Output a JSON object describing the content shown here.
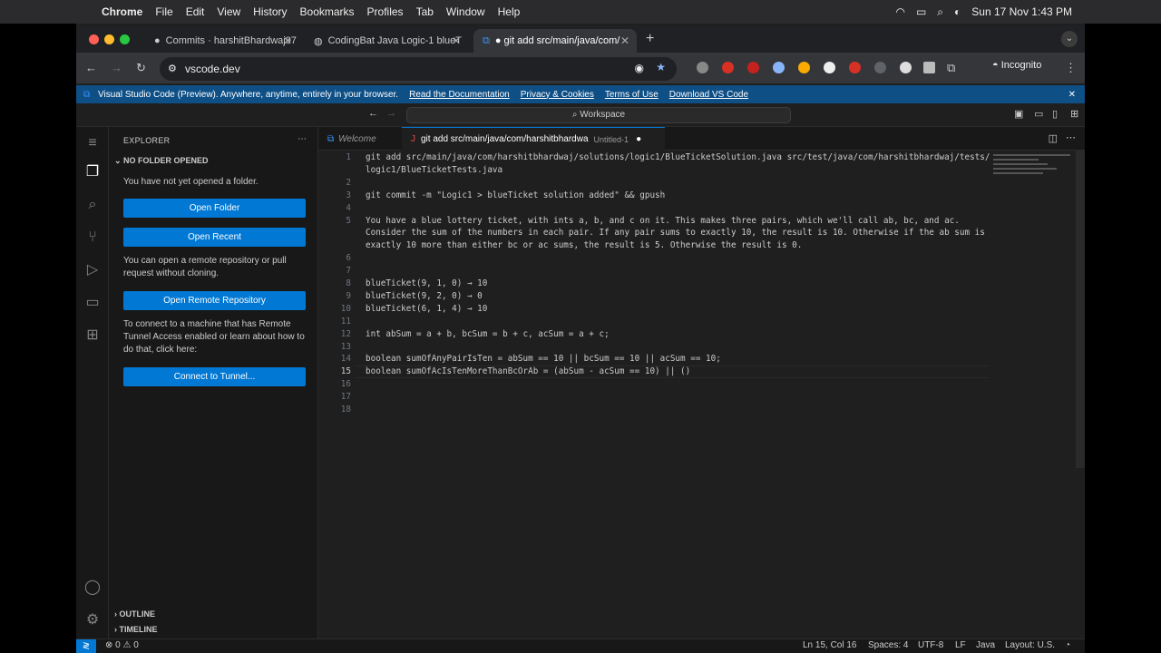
{
  "menubar": {
    "items": [
      "Chrome",
      "File",
      "Edit",
      "View",
      "History",
      "Bookmarks",
      "Profiles",
      "Tab",
      "Window",
      "Help"
    ],
    "clock": "Sun 17 Nov  1:43 PM"
  },
  "tabs": [
    {
      "title": "Commits · harshitBhardwaj97",
      "close": "✕"
    },
    {
      "title": "CodingBat Java Logic-1 blueT",
      "close": "✕"
    },
    {
      "title": "● git add src/main/java/com/",
      "close": "✕"
    }
  ],
  "newtab": "+",
  "address": {
    "url": "vscode.dev"
  },
  "incognito": "Incognito",
  "banner": {
    "text": "Visual Studio Code (Preview). Anywhere, anytime, entirely in your browser.",
    "links": [
      "Read the Documentation",
      "Privacy & Cookies",
      "Terms of Use",
      "Download VS Code"
    ],
    "close": "✕"
  },
  "command_center": "Workspace",
  "sidebar": {
    "title": "EXPLORER",
    "section": "NO FOLDER OPENED",
    "msg1": "You have not yet opened a folder.",
    "btn_open_folder": "Open Folder",
    "btn_open_recent": "Open Recent",
    "msg2": "You can open a remote repository or pull request without cloning.",
    "btn_remote": "Open Remote Repository",
    "msg3": "To connect to a machine that has Remote Tunnel Access enabled or learn about how to do that, click here:",
    "btn_tunnel": "Connect to Tunnel...",
    "outline": "OUTLINE",
    "timeline": "TIMELINE"
  },
  "editor_tabs": [
    {
      "label": "Welcome",
      "desc": ""
    },
    {
      "label": "git add src/main/java/com/harshitbhardwa",
      "desc": "Untitled-1",
      "dirty": "●"
    }
  ],
  "code_lines": [
    {
      "n": "1",
      "t": "git add src/main/java/com/harshitbhardwaj/solutions/logic1/BlueTicketSolution.java src/test/java/com/harshitbhardwaj/tests/"
    },
    {
      "n": "",
      "t": "logic1/BlueTicketTests.java"
    },
    {
      "n": "2",
      "t": ""
    },
    {
      "n": "3",
      "t": "git commit -m \"Logic1 > blueTicket solution added\" && gpush"
    },
    {
      "n": "4",
      "t": ""
    },
    {
      "n": "5",
      "t": "You have a blue lottery ticket, with ints a, b, and c on it. This makes three pairs, which we'll call ab, bc, and ac."
    },
    {
      "n": "",
      "t": "Consider the sum of the numbers in each pair. If any pair sums to exactly 10, the result is 10. Otherwise if the ab sum is"
    },
    {
      "n": "",
      "t": "exactly 10 more than either bc or ac sums, the result is 5. Otherwise the result is 0."
    },
    {
      "n": "6",
      "t": ""
    },
    {
      "n": "7",
      "t": ""
    },
    {
      "n": "8",
      "t": "blueTicket(9, 1, 0) → 10"
    },
    {
      "n": "9",
      "t": "blueTicket(9, 2, 0) → 0"
    },
    {
      "n": "10",
      "t": "blueTicket(6, 1, 4) → 10"
    },
    {
      "n": "11",
      "t": ""
    },
    {
      "n": "12",
      "t": "int abSum = a + b, bcSum = b + c, acSum = a + c;"
    },
    {
      "n": "13",
      "t": ""
    },
    {
      "n": "14",
      "t": "boolean sumOfAnyPairIsTen = abSum == 10 || bcSum == 10 || acSum == 10;"
    },
    {
      "n": "15",
      "t": "boolean sumOfAcIsTenMoreThanBcOrAb = (abSum - acSum == 10) || ()"
    },
    {
      "n": "16",
      "t": ""
    },
    {
      "n": "17",
      "t": ""
    },
    {
      "n": "18",
      "t": ""
    }
  ],
  "status": {
    "problems": "⊗ 0 ⚠ 0",
    "position": "Ln 15, Col 16",
    "spaces": "Spaces: 4",
    "encoding": "UTF-8",
    "eol": "LF",
    "language": "Java",
    "layout": "Layout: U.S."
  }
}
